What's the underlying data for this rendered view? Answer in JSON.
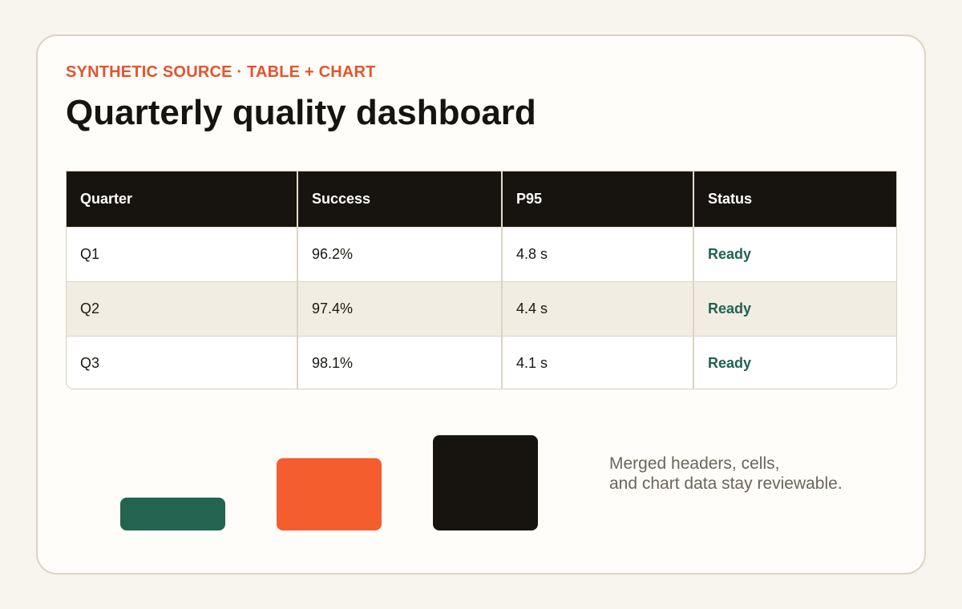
{
  "eyebrow": "SYNTHETIC SOURCE · TABLE + CHART",
  "title": "Quarterly quality dashboard",
  "table": {
    "headers": [
      "Quarter",
      "Success",
      "P95",
      "Status"
    ],
    "rows": [
      {
        "quarter": "Q1",
        "success": "96.2%",
        "p95": "4.8 s",
        "status": "Ready"
      },
      {
        "quarter": "Q2",
        "success": "97.4%",
        "p95": "4.4 s",
        "status": "Ready"
      },
      {
        "quarter": "Q3",
        "success": "98.1%",
        "p95": "4.1 s",
        "status": "Ready"
      }
    ]
  },
  "chart_data": {
    "type": "bar",
    "categories": [
      "Q1",
      "Q2",
      "Q3"
    ],
    "values": [
      96.2,
      97.4,
      98.1
    ],
    "colors": [
      "#226450",
      "#f45d2e",
      "#17140f"
    ],
    "title": "",
    "xlabel": "",
    "ylabel": "",
    "grid": false,
    "axes_visible": false
  },
  "note": {
    "line1": "Merged headers, cells,",
    "line2": "and chart data stay reviewable."
  }
}
